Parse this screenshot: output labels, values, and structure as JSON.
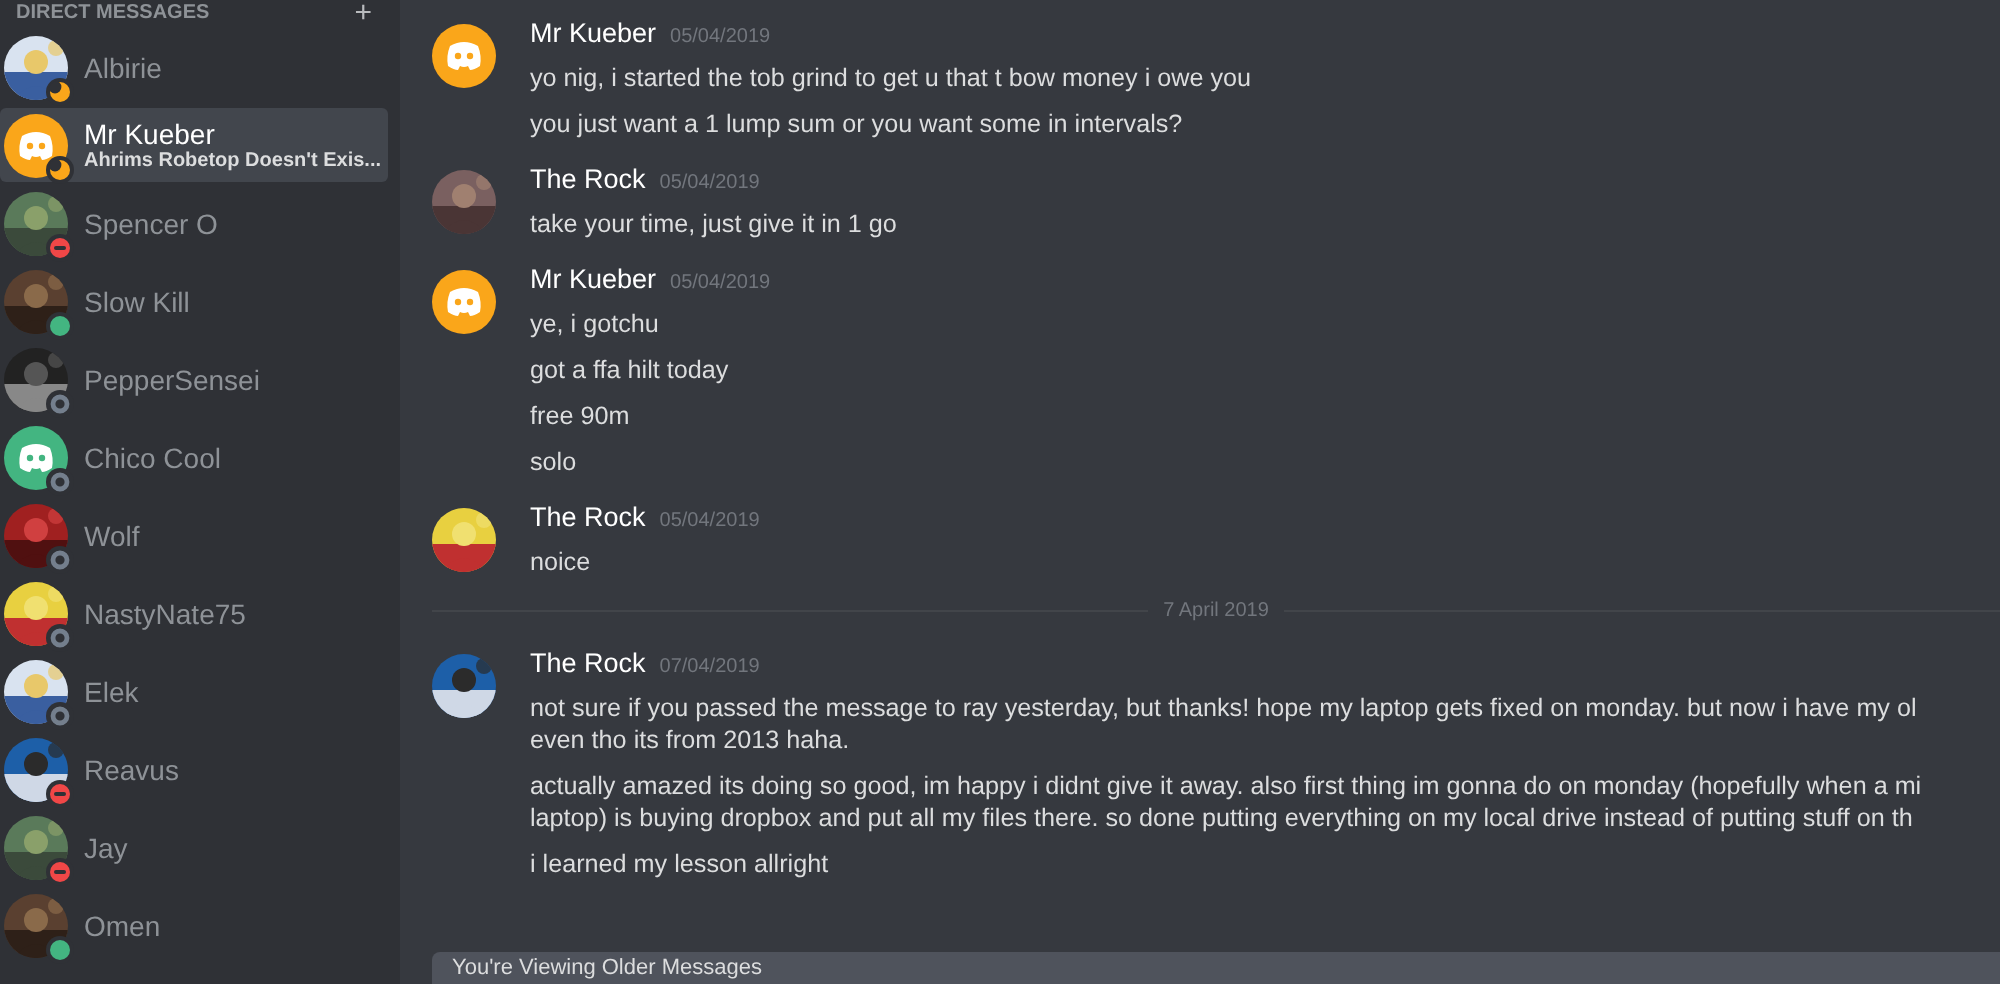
{
  "sidebar": {
    "header": "DIRECT MESSAGES",
    "add_label": "+",
    "items": [
      {
        "name": "Albirie",
        "status": {
          "kind": "idle"
        },
        "avatar": {
          "kind": "picture"
        },
        "selected": false
      },
      {
        "name": "Mr Kueber",
        "subtitle": "Ahrims Robetop Doesn't Exis...",
        "status": {
          "kind": "idle"
        },
        "avatar": {
          "kind": "logo",
          "color": "#faa61a"
        },
        "selected": true
      },
      {
        "name": "Spencer O",
        "status": {
          "kind": "dnd"
        },
        "avatar": {
          "kind": "picture"
        },
        "selected": false
      },
      {
        "name": "Slow Kill",
        "status": {
          "kind": "online"
        },
        "avatar": {
          "kind": "picture"
        },
        "selected": false
      },
      {
        "name": "PepperSensei",
        "status": {
          "kind": "offline"
        },
        "avatar": {
          "kind": "picture"
        },
        "selected": false
      },
      {
        "name": "Chico Cool",
        "status": {
          "kind": "offline"
        },
        "avatar": {
          "kind": "logo",
          "color": "#43b581"
        },
        "selected": false
      },
      {
        "name": "Wolf",
        "status": {
          "kind": "offline"
        },
        "avatar": {
          "kind": "picture"
        },
        "selected": false
      },
      {
        "name": "NastyNate75",
        "status": {
          "kind": "offline"
        },
        "avatar": {
          "kind": "picture"
        },
        "selected": false
      },
      {
        "name": "Elek",
        "status": {
          "kind": "offline"
        },
        "avatar": {
          "kind": "picture"
        },
        "selected": false
      },
      {
        "name": "Reavus",
        "status": {
          "kind": "dnd"
        },
        "avatar": {
          "kind": "picture"
        },
        "selected": false
      },
      {
        "name": "Jay",
        "status": {
          "kind": "dnd"
        },
        "avatar": {
          "kind": "picture"
        },
        "selected": false
      },
      {
        "name": "Omen",
        "status": {
          "kind": "online"
        },
        "avatar": {
          "kind": "picture"
        },
        "selected": false
      }
    ]
  },
  "chat": {
    "entries": [
      {
        "kind": "message",
        "author": "Mr Kueber",
        "time": "05/04/2019",
        "avatar": {
          "kind": "logo",
          "color": "#faa61a"
        },
        "lines": [
          "yo nig, i started the tob grind to get u that t bow money i owe you",
          "you just want a 1 lump sum or you want some in intervals?"
        ]
      },
      {
        "kind": "message",
        "author": "The Rock",
        "time": "05/04/2019",
        "avatar": {
          "kind": "picture"
        },
        "lines": [
          "take your time, just give it in 1 go"
        ]
      },
      {
        "kind": "message",
        "author": "Mr Kueber",
        "time": "05/04/2019",
        "avatar": {
          "kind": "logo",
          "color": "#faa61a"
        },
        "lines": [
          "ye, i gotchu",
          "got a ffa hilt today",
          "free 90m",
          "solo"
        ]
      },
      {
        "kind": "message",
        "author": "The Rock",
        "time": "05/04/2019",
        "avatar": {
          "kind": "picture"
        },
        "lines": [
          "noice"
        ]
      },
      {
        "kind": "divider",
        "label": "7 April 2019"
      },
      {
        "kind": "message",
        "author": "The Rock",
        "time": "07/04/2019",
        "avatar": {
          "kind": "picture"
        },
        "lines": [
          "not sure if you passed the message to ray yesterday, but thanks! hope my laptop gets fixed on monday. but now i have my ol\neven tho its from 2013 haha.",
          "actually amazed its doing so good, im happy i didnt give it away. also first thing im gonna do on monday (hopefully when a mi\nlaptop) is buying dropbox and put all my files there. so done putting everything on my local drive instead of putting stuff on th",
          "i learned my lesson allright"
        ]
      }
    ],
    "older_notice": "You're Viewing Older Messages"
  }
}
